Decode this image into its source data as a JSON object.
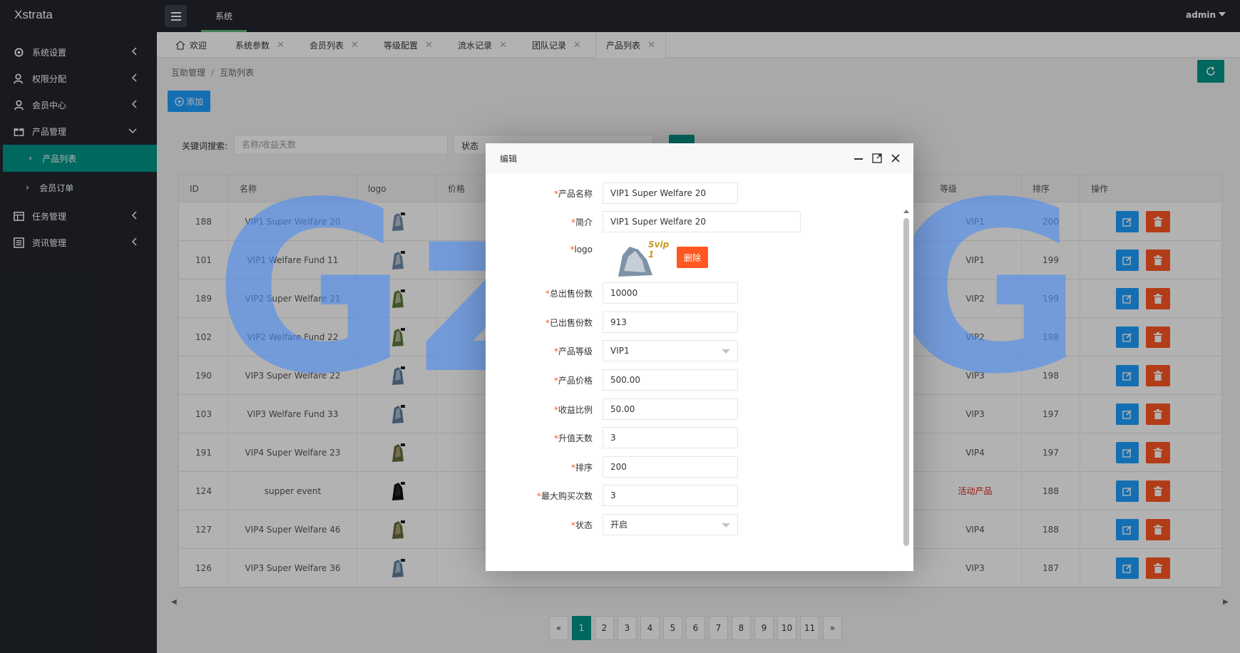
{
  "header": {
    "brand": "Xstrata",
    "nav_label": "系统",
    "user": "admin"
  },
  "sidebar": {
    "items": [
      {
        "label": "系统设置",
        "icon": "gear-icon"
      },
      {
        "label": "权限分配",
        "icon": "user-group-icon"
      },
      {
        "label": "会员中心",
        "icon": "user-icon"
      },
      {
        "label": "产品管理",
        "icon": "gift-icon"
      },
      {
        "label": "任务管理",
        "icon": "grid-icon"
      },
      {
        "label": "资讯管理",
        "icon": "list-icon"
      }
    ],
    "sub_items": [
      {
        "label": "产品列表",
        "active": true
      },
      {
        "label": "会员订单",
        "active": false
      }
    ]
  },
  "tabs": [
    {
      "label": "欢迎"
    },
    {
      "label": "系统参数"
    },
    {
      "label": "会员列表"
    },
    {
      "label": "等级配置"
    },
    {
      "label": "流水记录"
    },
    {
      "label": "团队记录"
    },
    {
      "label": "产品列表"
    }
  ],
  "breadcrumb": {
    "parent": "互助管理",
    "separator": "/",
    "current": "互助列表"
  },
  "toolbar": {
    "add_label": "添加"
  },
  "search": {
    "label": "关键词搜索:",
    "placeholder": "名称/收益天数",
    "status_label": "状态"
  },
  "table": {
    "headers": [
      "ID",
      "名称",
      "logo",
      "价格",
      "等级",
      "排序",
      "操作"
    ],
    "rows": [
      {
        "id": "188",
        "name": "VIP1 Super Welfare 20",
        "level": "VIP1",
        "sort": "200"
      },
      {
        "id": "101",
        "name": "VIP1 Welfare Fund 11",
        "level": "VIP1",
        "sort": "199"
      },
      {
        "id": "189",
        "name": "VIP2 Super Welfare 21",
        "level": "VIP2",
        "sort": "199"
      },
      {
        "id": "102",
        "name": "VIP2 Welfare Fund 22",
        "level": "VIP2",
        "sort": "198"
      },
      {
        "id": "190",
        "name": "VIP3 Super Welfare 22",
        "level": "VIP3",
        "sort": "198"
      },
      {
        "id": "103",
        "name": "VIP3 Welfare Fund 33",
        "level": "VIP3",
        "sort": "197"
      },
      {
        "id": "191",
        "name": "VIP4 Super Welfare 23",
        "level": "VIP4",
        "sort": "197"
      },
      {
        "id": "124",
        "name": "supper event",
        "level": "活动产品",
        "sort": "188"
      },
      {
        "id": "127",
        "name": "VIP4 Super Welfare 46",
        "level": "VIP4",
        "sort": "188"
      },
      {
        "id": "126",
        "name": "VIP3 Super Welfare 36",
        "level": "VIP3",
        "sort": "187"
      }
    ]
  },
  "pagination": {
    "prev": "«",
    "next": "»",
    "pages": [
      "1",
      "2",
      "3",
      "4",
      "5",
      "6",
      "7",
      "8",
      "9",
      "10",
      "11"
    ],
    "current": "1"
  },
  "modal": {
    "title": "编辑",
    "fields": [
      {
        "label": "产品名称",
        "value": "VIP1 Super Welfare 20"
      },
      {
        "label": "简介",
        "value": "VIP1 Super Welfare 20"
      },
      {
        "label": "logo",
        "value": ""
      },
      {
        "label": "总出售份数",
        "value": "10000"
      },
      {
        "label": "已出售份数",
        "value": "913"
      },
      {
        "label": "产品等级",
        "value": "VIP1"
      },
      {
        "label": "产品价格",
        "value": "500.00"
      },
      {
        "label": "收益比例",
        "value": "50.00"
      },
      {
        "label": "升值天数",
        "value": "3"
      },
      {
        "label": "排序",
        "value": "200"
      },
      {
        "label": "最大购买次数",
        "value": "3"
      },
      {
        "label": "状态",
        "value": "开启"
      }
    ],
    "logo_caption": "Svip 1",
    "delete_label": "删除"
  },
  "watermark": "GzLoG",
  "colors": {
    "primary": "#009688",
    "blue": "#1e9fff",
    "danger": "#ff5722",
    "sidebar": "#23262e",
    "event_text": "#e02020"
  }
}
